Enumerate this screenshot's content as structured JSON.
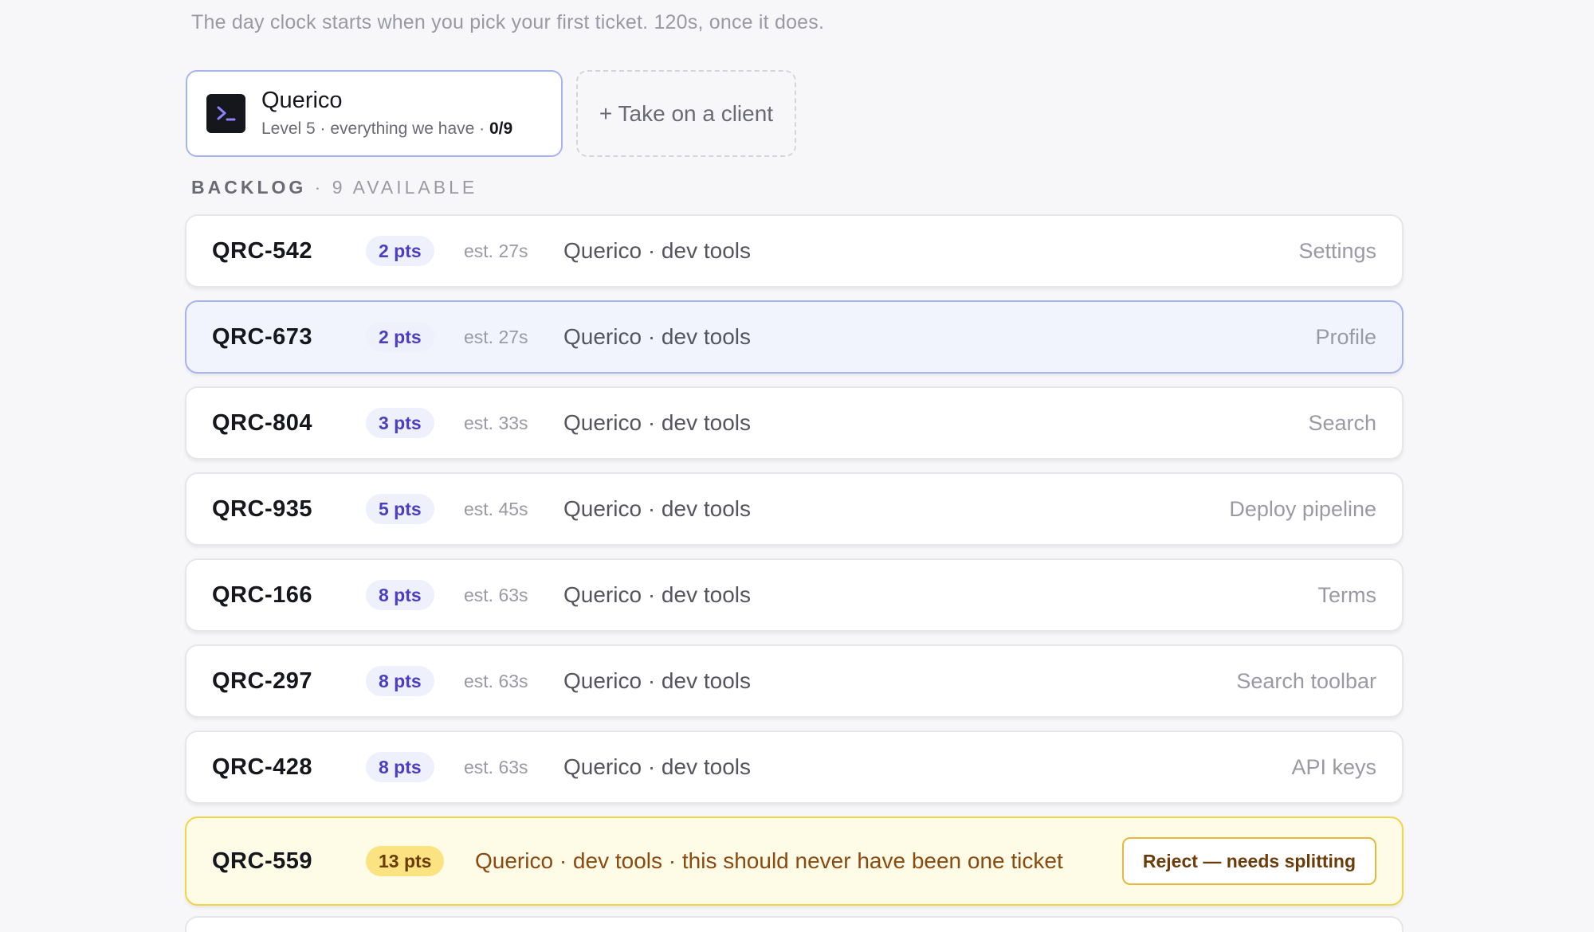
{
  "hint": "The day clock starts when you pick your first ticket. 120s, once it does.",
  "client": {
    "name": "Querico",
    "meta": "Level 5 · everything we have · ",
    "progress": "0/9",
    "icon": "terminal-icon"
  },
  "take_client_label": "+ Take on a client",
  "backlog": {
    "label": "BACKLOG",
    "separator": " · ",
    "available": "9 AVAILABLE"
  },
  "tickets": [
    {
      "id": "QRC-542",
      "pts": "2 pts",
      "est": "est. 27s",
      "desc": "Querico · dev tools",
      "area": "Settings",
      "state": "normal"
    },
    {
      "id": "QRC-673",
      "pts": "2 pts",
      "est": "est. 27s",
      "desc": "Querico · dev tools",
      "area": "Profile",
      "state": "selected"
    },
    {
      "id": "QRC-804",
      "pts": "3 pts",
      "est": "est. 33s",
      "desc": "Querico · dev tools",
      "area": "Search",
      "state": "normal"
    },
    {
      "id": "QRC-935",
      "pts": "5 pts",
      "est": "est. 45s",
      "desc": "Querico · dev tools",
      "area": "Deploy pipeline",
      "state": "normal"
    },
    {
      "id": "QRC-166",
      "pts": "8 pts",
      "est": "est. 63s",
      "desc": "Querico · dev tools",
      "area": "Terms",
      "state": "normal"
    },
    {
      "id": "QRC-297",
      "pts": "8 pts",
      "est": "est. 63s",
      "desc": "Querico · dev tools",
      "area": "Search toolbar",
      "state": "normal"
    },
    {
      "id": "QRC-428",
      "pts": "8 pts",
      "est": "est. 63s",
      "desc": "Querico · dev tools",
      "area": "API keys",
      "state": "normal"
    }
  ],
  "oversized_ticket": {
    "id": "QRC-559",
    "pts": "13 pts",
    "desc": "Querico · dev tools · this should never have been one ticket",
    "action": "Reject — needs splitting"
  },
  "colors": {
    "accent_border": "#a8b4f0",
    "points_text": "#4a3fc0",
    "warning_border": "#f3d34a",
    "warning_bg": "#fefbe6"
  }
}
